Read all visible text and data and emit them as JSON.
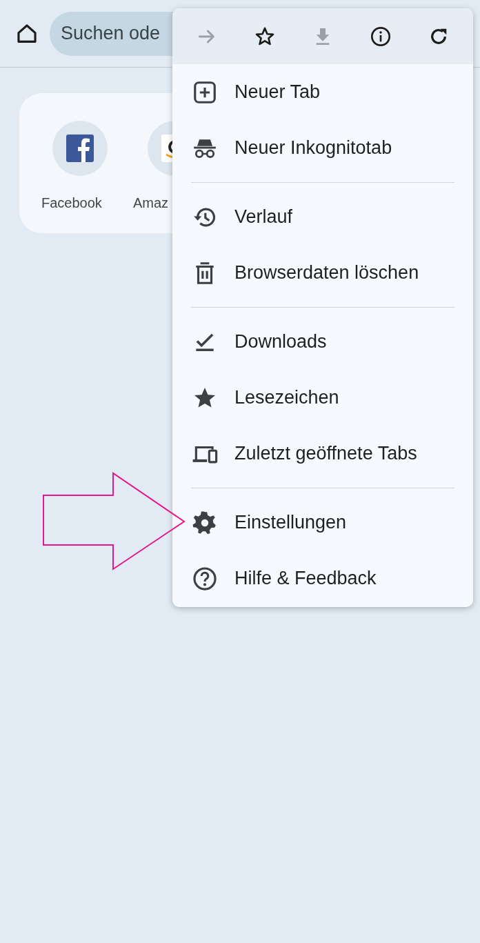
{
  "top_bar": {
    "search": {
      "placeholder": "Suchen ode"
    }
  },
  "shortcuts": [
    {
      "label": "Facebook",
      "kind": "facebook"
    },
    {
      "label": "Amaz",
      "kind": "amazon"
    }
  ],
  "menu": {
    "toolbar": [
      {
        "kind": "forward",
        "disabled": true
      },
      {
        "kind": "star",
        "disabled": false
      },
      {
        "kind": "download",
        "disabled": true
      },
      {
        "kind": "info",
        "disabled": false
      },
      {
        "kind": "reload",
        "disabled": false
      }
    ],
    "groups": [
      [
        {
          "kind": "new-tab",
          "label": "Neuer Tab"
        },
        {
          "kind": "incognito",
          "label": "Neuer Inkognitotab"
        }
      ],
      [
        {
          "kind": "history",
          "label": "Verlauf"
        },
        {
          "kind": "trash",
          "label": "Browserdaten löschen"
        }
      ],
      [
        {
          "kind": "downloads",
          "label": "Downloads"
        },
        {
          "kind": "bookmark",
          "label": "Lesezeichen"
        },
        {
          "kind": "devices",
          "label": "Zuletzt geöffnete Tabs"
        }
      ],
      [
        {
          "kind": "settings",
          "label": "Einstellungen"
        },
        {
          "kind": "help",
          "label": "Hilfe & Feedback"
        }
      ]
    ]
  }
}
